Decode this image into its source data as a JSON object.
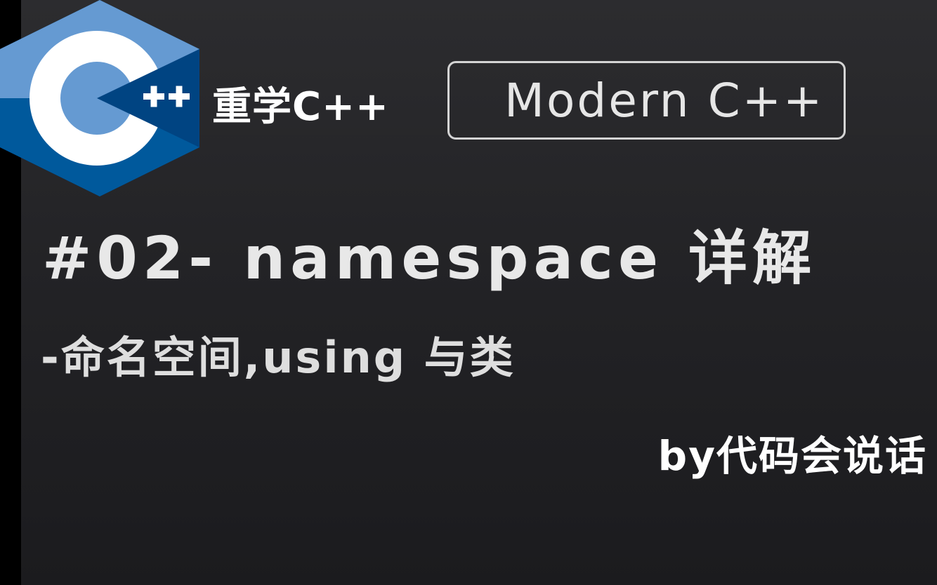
{
  "brand": {
    "title": "重学C++",
    "logo_icon": "cpp-hexagon-logo-icon",
    "colors": {
      "hex_light": "#659ad2",
      "hex_dark": "#00599c",
      "hex_mid": "#004482",
      "letter": "#ffffff"
    }
  },
  "tag": {
    "label": "Modern C++"
  },
  "lesson": {
    "title": "#02- namespace 详解",
    "subtitle": "-命名空间,using 与类"
  },
  "author": {
    "byline": "by代码会说话"
  },
  "theme": {
    "background": "#232326",
    "border": "#d4d4d4"
  }
}
